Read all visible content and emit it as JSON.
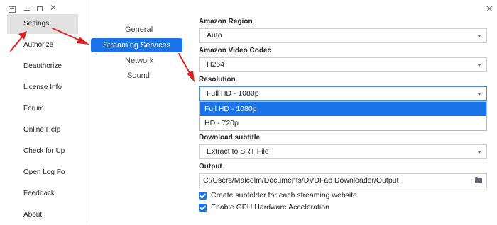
{
  "left_menu": {
    "items": [
      {
        "label": "Settings",
        "selected": true
      },
      {
        "label": "Authorize"
      },
      {
        "label": "Deauthorize"
      },
      {
        "label": "License Info"
      },
      {
        "label": "Forum"
      },
      {
        "label": "Online Help"
      },
      {
        "label": "Check for Up"
      },
      {
        "label": "Open Log Fo"
      },
      {
        "label": "Feedback"
      },
      {
        "label": "About"
      }
    ]
  },
  "tabs": [
    {
      "label": "General"
    },
    {
      "label": "Streaming Services",
      "active": true
    },
    {
      "label": "Network"
    },
    {
      "label": "Sound"
    }
  ],
  "settings": {
    "region_label": "Amazon Region",
    "region_value": "Auto",
    "codec_label": "Amazon Video Codec",
    "codec_value": "H264",
    "resolution_label": "Resolution",
    "resolution_value": "Full HD - 1080p",
    "resolution_options": [
      "Full HD - 1080p",
      "HD - 720p"
    ],
    "subtitle_label": "Download subtitle",
    "subtitle_value": "Extract to SRT File",
    "output_label": "Output",
    "output_value": "C:/Users/Malcolm/Documents/DVDFab Downloader/Output",
    "checkbox_subfolder": "Create subfolder for each streaming website",
    "checkbox_gpu": "Enable GPU Hardware Acceleration"
  },
  "icons": {
    "menu": "hamburger-icon",
    "minimize": "minimize-icon",
    "maximize": "maximize-icon",
    "close": "close-icon",
    "folder": "folder-icon",
    "caret": "chevron-down-icon"
  },
  "colors": {
    "accent": "#1a73e8",
    "arrow": "#e02020",
    "selected_menu_bg": "#e1e1e1"
  }
}
